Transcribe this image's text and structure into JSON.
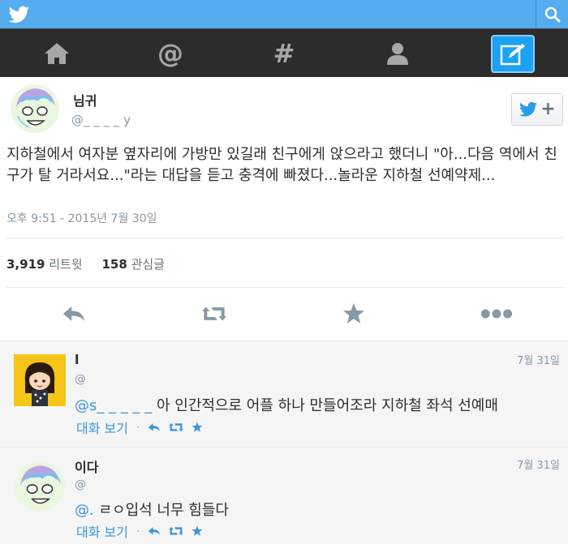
{
  "topbar": {
    "logo_icon": "twitter-bird-icon",
    "search_icon": "search-icon"
  },
  "nav": [
    {
      "icon": "home-icon",
      "glyph": "⌂"
    },
    {
      "icon": "mentions-icon",
      "glyph": "@"
    },
    {
      "icon": "discover-icon",
      "glyph": "#"
    },
    {
      "icon": "profile-icon",
      "glyph": ""
    },
    {
      "icon": "compose-icon",
      "glyph": ""
    }
  ],
  "tweet": {
    "name": "님귀",
    "handle": "@_ _ _ _ y",
    "follow_icon": "follow-bird-icon",
    "follow_plus": "+",
    "text": "지하철에서 여자분 옆자리에 가방만 있길래 친구에게 앉으라고 했더니 \"아...다음 역에서 친구가 탈 거라서요...\"라는 대답을 듣고 충격에 빠졌다...놀라운 지하철 선예약제...",
    "timestamp": "오후 9:51 - 2015년 7월 30일",
    "retweets_count": "3,919",
    "retweets_label": "리트윗",
    "favorites_count": "158",
    "favorites_label": "관심글"
  },
  "replies": [
    {
      "name": "l  ",
      "handle": "@   ",
      "date": "7월 31일",
      "mention": "@s_ _ _ _ _",
      "text": "아 인간적으로 어플 하나 만들어조라 지하철 좌석 선예매",
      "conversation_label": "대화 보기"
    },
    {
      "name": "이다",
      "handle": "@",
      "date": "7월 31일",
      "mention": "@.        ",
      "text": "ㄹㅇ입석 너무 힘들다",
      "conversation_label": "대화 보기"
    }
  ],
  "colors": {
    "brand": "#55acee",
    "nav_bg": "#2c2c2c",
    "link": "#3b94d9",
    "muted": "#8899a6"
  }
}
